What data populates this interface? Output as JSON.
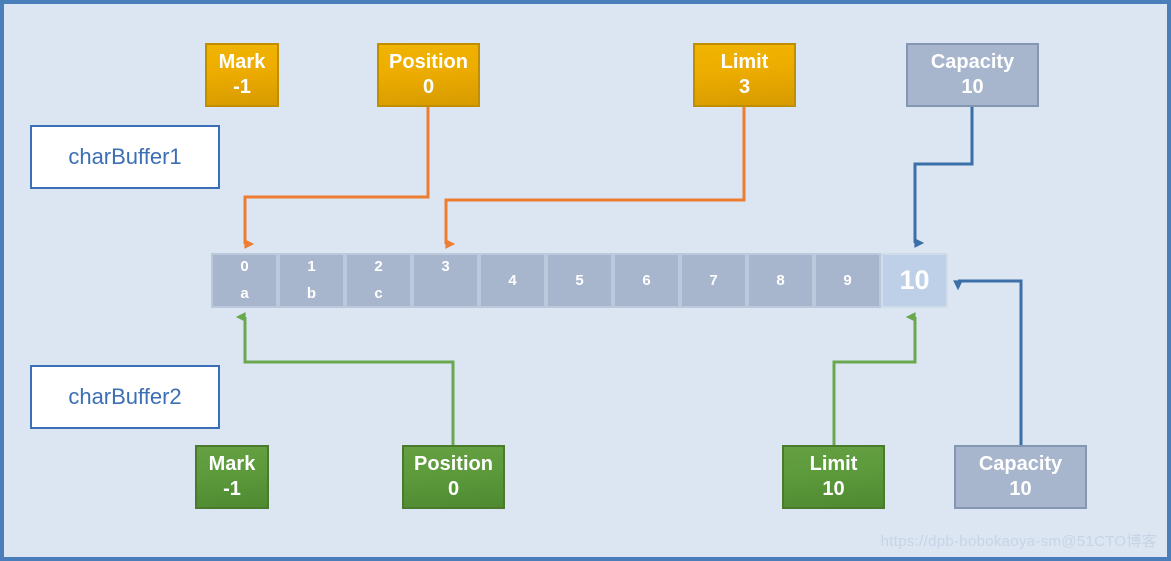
{
  "diagram": {
    "title_plates": [
      {
        "name": "charBuffer1",
        "label": "charBuffer1"
      },
      {
        "name": "charBuffer2",
        "label": "charBuffer2"
      }
    ],
    "watermark": "https://dpb-bobokaoya-sm@51CTO博客",
    "colors": {
      "background": "#dce6f2",
      "border": "#4a7ebb",
      "gold": "#eead00",
      "gold_border": "#bf8f00",
      "green": "#5c9a3c",
      "green_border": "#4c7a2c",
      "steel": "#a7b5cd",
      "steel_border": "#8496b2",
      "cell_fill": "#a7b5cd",
      "cell_border": "#bcc8dc",
      "capacity_cell_fill": "#bdd0e8",
      "orange_wire": "#ed7d31",
      "green_wire": "#6aa84f",
      "blue_wire": "#3b6fa8",
      "plate_text": "#3b6fb6"
    }
  },
  "charBuffer1": {
    "plate_label": "charBuffer1",
    "mark": {
      "label": "Mark",
      "value": "-1"
    },
    "position": {
      "label": "Position",
      "value": "0"
    },
    "limit": {
      "label": "Limit",
      "value": "3"
    },
    "capacity": {
      "label": "Capacity",
      "value": "10"
    }
  },
  "charBuffer2": {
    "plate_label": "charBuffer2",
    "mark": {
      "label": "Mark",
      "value": "-1"
    },
    "position": {
      "label": "Position",
      "value": "0"
    },
    "limit": {
      "label": "Limit",
      "value": "10"
    },
    "capacity": {
      "label": "Capacity",
      "value": "10"
    }
  },
  "buffer": {
    "cells": [
      {
        "index": "0",
        "value": "a",
        "kind": "filled"
      },
      {
        "index": "1",
        "value": "b",
        "kind": "filled"
      },
      {
        "index": "2",
        "value": "c",
        "kind": "filled"
      },
      {
        "index": "3",
        "value": "",
        "kind": "indexed"
      },
      {
        "index": "4",
        "value": "",
        "kind": "mid"
      },
      {
        "index": "5",
        "value": "",
        "kind": "mid"
      },
      {
        "index": "6",
        "value": "",
        "kind": "mid"
      },
      {
        "index": "7",
        "value": "",
        "kind": "mid"
      },
      {
        "index": "8",
        "value": "",
        "kind": "mid"
      },
      {
        "index": "9",
        "value": "",
        "kind": "mid"
      },
      {
        "index": "10",
        "value": "",
        "kind": "capacity"
      }
    ]
  }
}
